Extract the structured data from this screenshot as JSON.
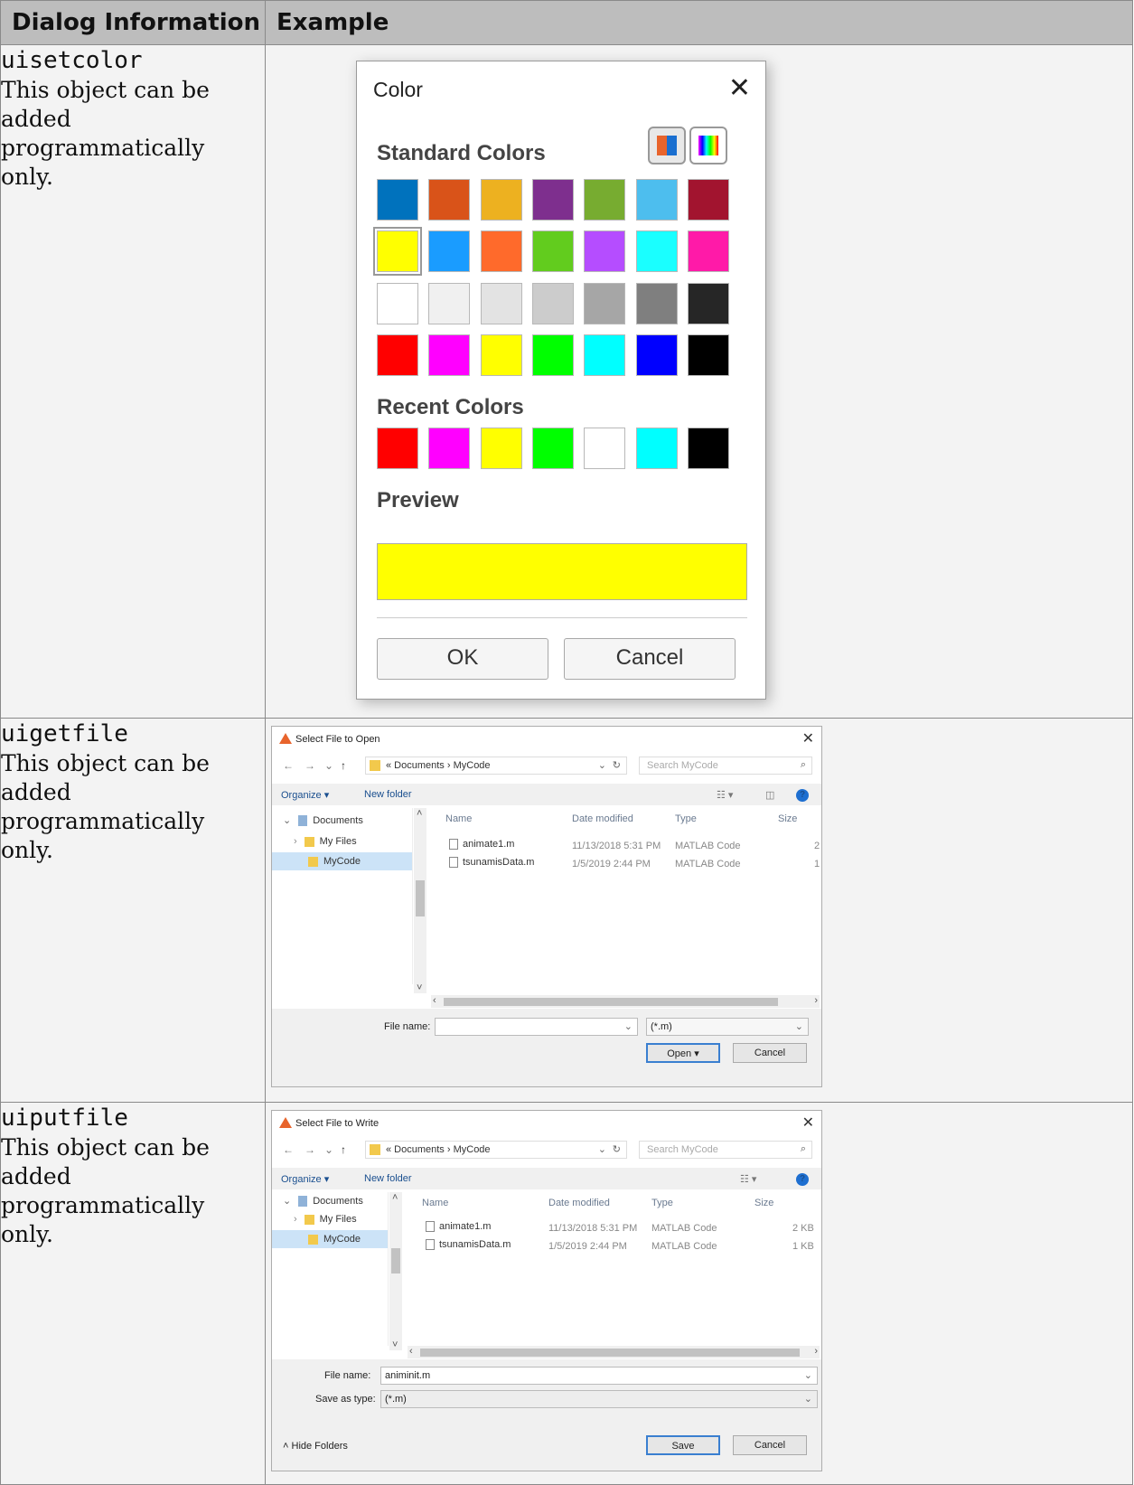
{
  "table": {
    "headers": [
      "Dialog Information",
      "Example"
    ],
    "rows": [
      {
        "code": "uisetcolor",
        "desc": "This object can be added programmatically only."
      },
      {
        "code": "uigetfile",
        "desc": "This object can be added programmatically only."
      },
      {
        "code": "uiputfile",
        "desc": "This object can be added programmatically only."
      }
    ]
  },
  "color_dialog": {
    "title": "Color",
    "close_icon": "close-icon",
    "standard_heading": "Standard Colors",
    "recent_heading": "Recent Colors",
    "preview_heading": "Preview",
    "standard_colors": [
      [
        "#0072bd",
        "#d95319",
        "#edb120",
        "#7e2f8e",
        "#77ac30",
        "#4dbeee",
        "#a2142f"
      ],
      [
        "#ffff00",
        "#1a9cff",
        "#ff6a2b",
        "#62cc1e",
        "#b54dff",
        "#1affff",
        "#ff1aa8"
      ],
      [
        "#ffffff",
        "#f0f0f0",
        "#e3e3e3",
        "#cccccc",
        "#a6a6a6",
        "#7f7f7f",
        "#262626"
      ],
      [
        "#ff0000",
        "#ff00ff",
        "#ffff00",
        "#00ff00",
        "#00ffff",
        "#0000ff",
        "#000000"
      ]
    ],
    "selected_color": "#ffff00",
    "recent_colors": [
      "#ff0000",
      "#ff00ff",
      "#ffff00",
      "#00ff00",
      "#ffffff",
      "#00ffff",
      "#000000"
    ],
    "preview_color": "#ffff00",
    "ok_label": "OK",
    "cancel_label": "Cancel"
  },
  "open_dialog": {
    "title": "Select File to Open",
    "path": "« Documents › MyCode",
    "search_placeholder": "Search MyCode",
    "organize_label": "Organize ▾",
    "new_folder_label": "New folder",
    "tree": [
      "Documents",
      "My Files",
      "MyCode"
    ],
    "columns": [
      "Name",
      "Date modified",
      "Type",
      "Size"
    ],
    "files": [
      {
        "name": "animate1.m",
        "date": "11/13/2018 5:31 PM",
        "type": "MATLAB Code",
        "size": "2"
      },
      {
        "name": "tsunamisData.m",
        "date": "1/5/2019 2:44 PM",
        "type": "MATLAB Code",
        "size": "1"
      }
    ],
    "filename_label": "File name:",
    "filename_value": "",
    "filter_value": "(*.m)",
    "open_label": "Open",
    "cancel_label": "Cancel"
  },
  "save_dialog": {
    "title": "Select File to Write",
    "path": "« Documents › MyCode",
    "search_placeholder": "Search MyCode",
    "organize_label": "Organize ▾",
    "new_folder_label": "New folder",
    "tree": [
      "Documents",
      "My Files",
      "MyCode"
    ],
    "columns": [
      "Name",
      "Date modified",
      "Type",
      "Size"
    ],
    "files": [
      {
        "name": "animate1.m",
        "date": "11/13/2018 5:31 PM",
        "type": "MATLAB Code",
        "size": "2 KB"
      },
      {
        "name": "tsunamisData.m",
        "date": "1/5/2019 2:44 PM",
        "type": "MATLAB Code",
        "size": "1 KB"
      }
    ],
    "filename_label": "File name:",
    "filename_value": "animinit.m",
    "savetype_label": "Save as type:",
    "savetype_value": "(*.m)",
    "hide_folders_label": "Hide Folders",
    "save_label": "Save",
    "cancel_label": "Cancel"
  }
}
